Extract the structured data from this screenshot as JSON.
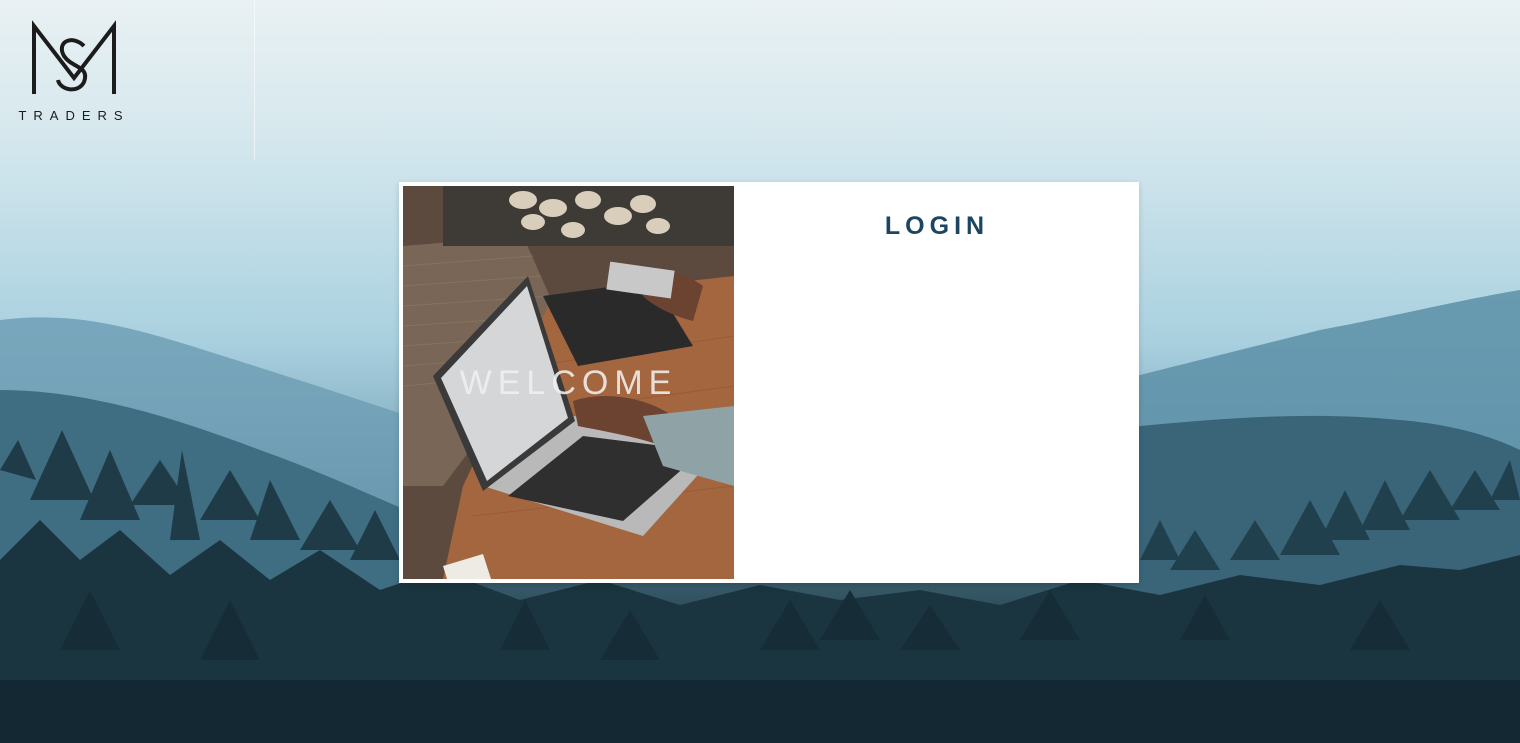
{
  "brand": {
    "logo_text": "TRADERS"
  },
  "card": {
    "welcome_text": "WELCOME",
    "login_title": "LOGIN"
  },
  "colors": {
    "title": "#1b4560",
    "card_bg": "#ffffff",
    "forest_dark": "#1c3440",
    "sky": "#d6e8ee"
  }
}
